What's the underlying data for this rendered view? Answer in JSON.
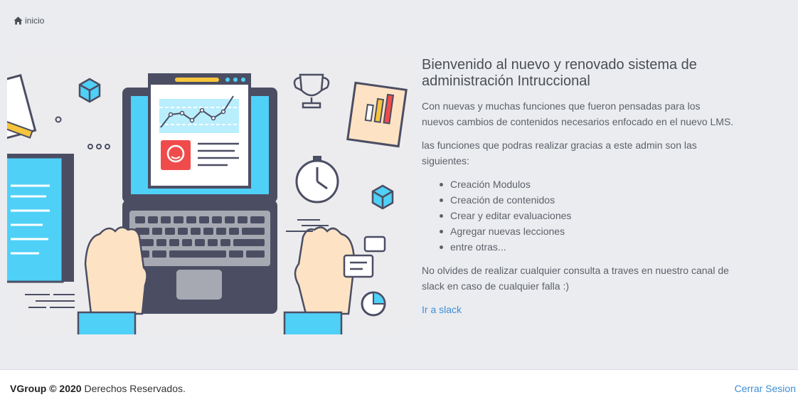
{
  "breadcrumb": {
    "home_label": "inicio",
    "icon": "home-icon"
  },
  "main": {
    "title": "Bienvenido al nuevo y renovado sistema de administración Intruccional",
    "intro": "Con nuevas y muchas funciones que fueron pensadas para los nuevos cambios de contenidos necesarios enfocado en el nuevo LMS.",
    "functions_intro": "las funciones que podras realizar gracias a este admin son las siguientes:",
    "functions": [
      "Creación Modulos",
      "Creación de contenidos",
      "Crear y editar evaluaciones",
      "Agregar nuevas lecciones",
      "entre otras..."
    ],
    "note": "No olvides de realizar cualquier consulta a traves en nuestro canal de slack en caso de cualquier falla :)",
    "slack_link": "Ir a slack"
  },
  "footer": {
    "brand": "VGroup © 2020",
    "rights": "Derechos Reservados.",
    "logout": "Cerrar Sesion"
  },
  "colors": {
    "page_bg": "#eaecf0",
    "link": "#3e8fd6",
    "accent_blue": "#4fd0f7",
    "accent_red": "#f04b4b"
  }
}
